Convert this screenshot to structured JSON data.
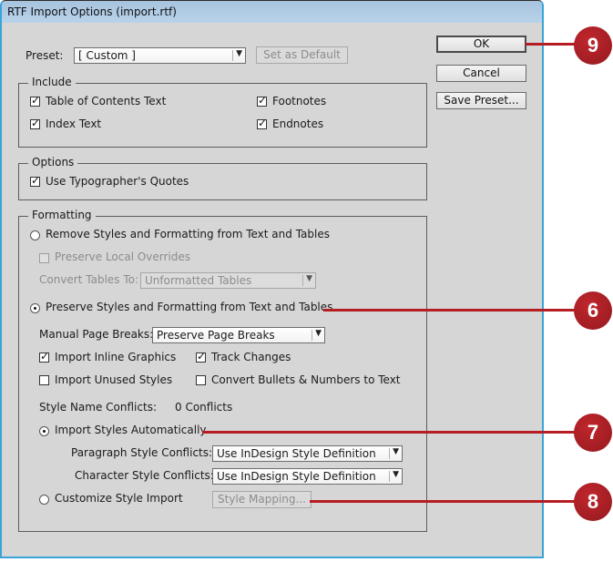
{
  "window": {
    "title": "RTF Import Options (import.rtf)"
  },
  "preset": {
    "label": "Preset:",
    "value": "[ Custom ]",
    "set_default_label": "Set as Default"
  },
  "buttons": {
    "ok": "OK",
    "cancel": "Cancel",
    "save_preset": "Save Preset..."
  },
  "include": {
    "title": "Include",
    "items": [
      {
        "label": "Table of Contents Text",
        "checked": true
      },
      {
        "label": "Index Text",
        "checked": true
      },
      {
        "label": "Footnotes",
        "checked": true
      },
      {
        "label": "Endnotes",
        "checked": true
      }
    ]
  },
  "options": {
    "title": "Options",
    "typographers_quotes": {
      "label": "Use Typographer's Quotes",
      "checked": true
    }
  },
  "formatting": {
    "title": "Formatting",
    "remove_styles": {
      "label": "Remove Styles and Formatting from Text and Tables",
      "selected": false
    },
    "preserve_local_overrides": {
      "label": "Preserve Local Overrides",
      "checked": false,
      "enabled": false
    },
    "convert_tables": {
      "label": "Convert Tables To:",
      "value": "Unformatted Tables",
      "enabled": false
    },
    "preserve_styles": {
      "label": "Preserve Styles and Formatting from Text and Tables",
      "selected": true
    },
    "manual_page_breaks": {
      "label": "Manual Page Breaks:",
      "value": "Preserve Page Breaks"
    },
    "import_inline_graphics": {
      "label": "Import Inline Graphics",
      "checked": true
    },
    "track_changes": {
      "label": "Track Changes",
      "checked": true
    },
    "import_unused_styles": {
      "label": "Import Unused Styles",
      "checked": false
    },
    "convert_bullets": {
      "label": "Convert Bullets & Numbers to Text",
      "checked": false
    },
    "style_name_conflicts": {
      "label": "Style Name Conflicts:",
      "value": "0 Conflicts"
    },
    "import_styles_auto": {
      "label": "Import Styles Automatically",
      "selected": true
    },
    "paragraph_conflicts": {
      "label": "Paragraph Style Conflicts:",
      "value": "Use InDesign Style Definition"
    },
    "character_conflicts": {
      "label": "Character Style Conflicts:",
      "value": "Use InDesign Style Definition"
    },
    "customize_import": {
      "label": "Customize Style Import",
      "selected": false
    },
    "style_mapping_label": "Style Mapping..."
  },
  "callouts": [
    "9",
    "6",
    "7",
    "8"
  ],
  "colors": {
    "callout": "#b51d22",
    "window_border": "#3aa3d8",
    "dialog_bg": "#d6d6d6"
  }
}
